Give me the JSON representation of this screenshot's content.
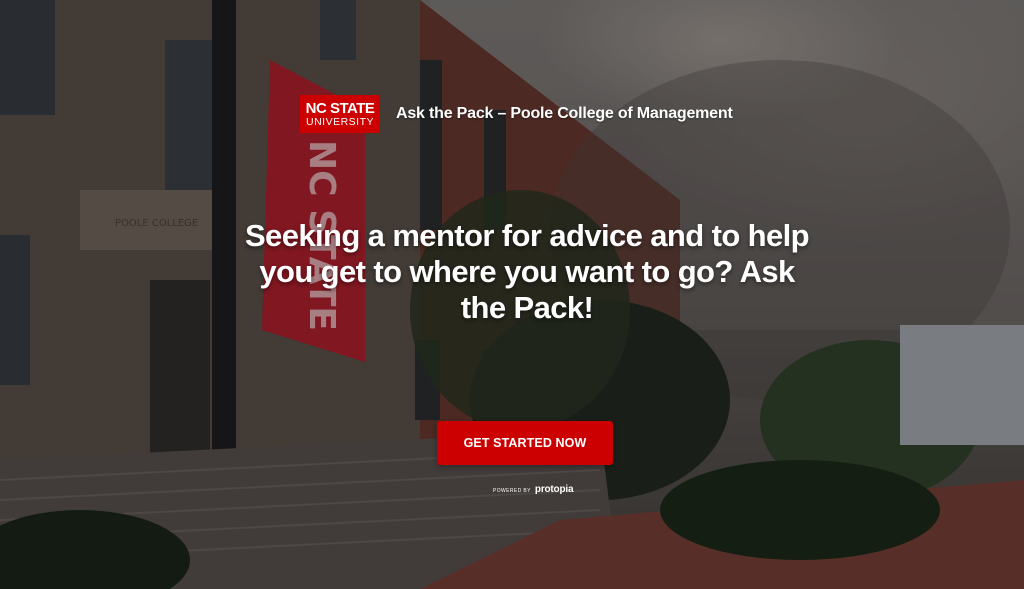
{
  "header": {
    "logo_line1": "NC STATE",
    "logo_line2": "UNIVERSITY",
    "title": "Ask the Pack – Poole College of Management"
  },
  "hero": {
    "headline_line1": "Seeking a mentor for advice and to help",
    "headline_line2": "you get to where you want to go? Ask",
    "headline_line3": "the Pack!"
  },
  "cta": {
    "label": "GET STARTED NOW"
  },
  "footer": {
    "powered_by": "POWERED BY",
    "brand": "protopia"
  },
  "background": {
    "banner_text": "NC STATE",
    "engraving": "POOLE COLLEGE"
  },
  "colors": {
    "brand_red": "#cc0000",
    "text": "#ffffff"
  }
}
